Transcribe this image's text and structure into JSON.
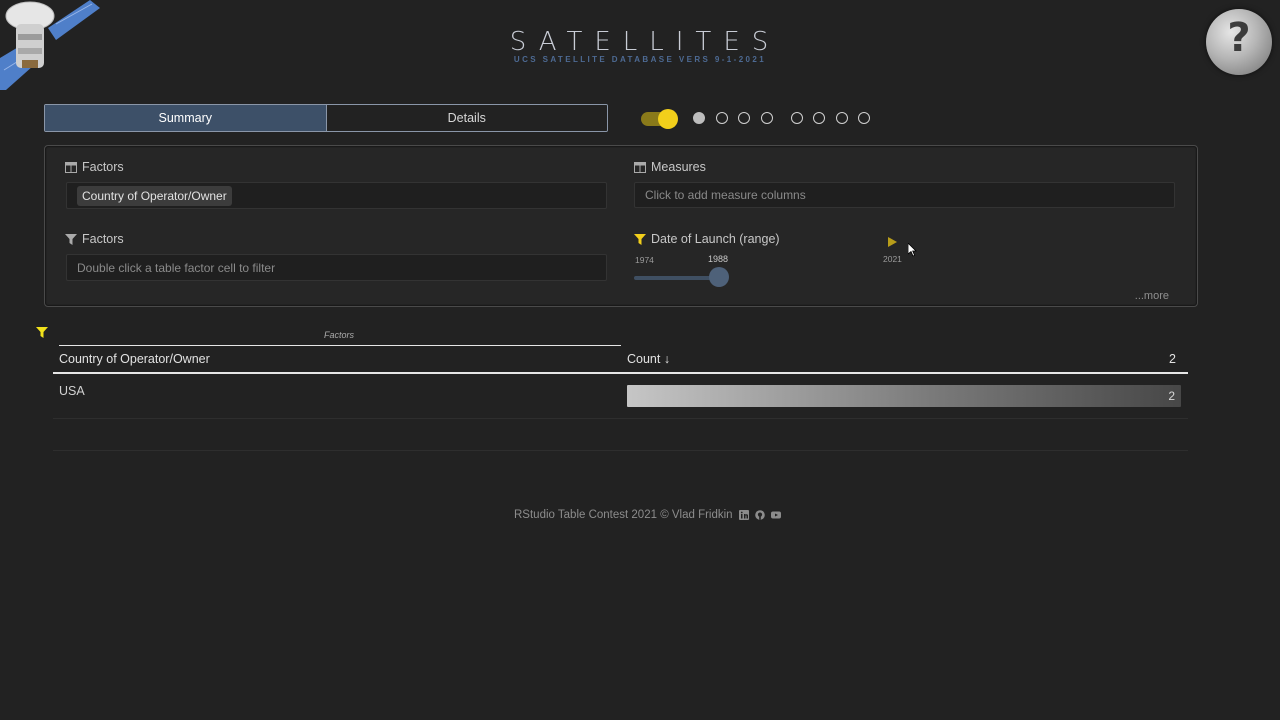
{
  "app": {
    "title": "SATELLITES",
    "subtitle": "UCS SATELLITE DATABASE VERS 9-1-2021",
    "help_symbol": "?"
  },
  "tabs": [
    {
      "label": "Summary",
      "active": true
    },
    {
      "label": "Details",
      "active": false
    }
  ],
  "toggle": {
    "on": true,
    "accent": "#f2cf1b"
  },
  "step_dots": [
    {
      "filled": true
    },
    {
      "filled": false
    },
    {
      "filled": false
    },
    {
      "filled": false
    },
    {
      "filled": false
    },
    {
      "filled": false
    },
    {
      "filled": false
    },
    {
      "filled": false
    }
  ],
  "panel": {
    "factors_columns": {
      "label": "Factors",
      "chip": "Country of Operator/Owner"
    },
    "factors_filter": {
      "label": "Factors",
      "placeholder": "Double click a table factor cell to filter"
    },
    "measures": {
      "label": "Measures",
      "placeholder": "Click to add measure columns"
    },
    "date_filter": {
      "label": "Date of Launch (range)",
      "min": "1974",
      "current": "1988",
      "max": "2021",
      "value_fraction": 0.298
    },
    "more": "...more"
  },
  "table": {
    "group_label": "Factors",
    "columns": {
      "factor": "Country of Operator/Owner",
      "count": "Count ↓",
      "total": "2"
    },
    "rows": [
      {
        "country": "USA",
        "count": "2"
      }
    ]
  },
  "footer": {
    "text": "RStudio Table Contest 2021 © Vlad Fridkin"
  },
  "colors": {
    "background": "#222222",
    "tab_active": "#3d5068",
    "accent_yellow": "#f2cf1b",
    "slider": "#4e6179"
  }
}
